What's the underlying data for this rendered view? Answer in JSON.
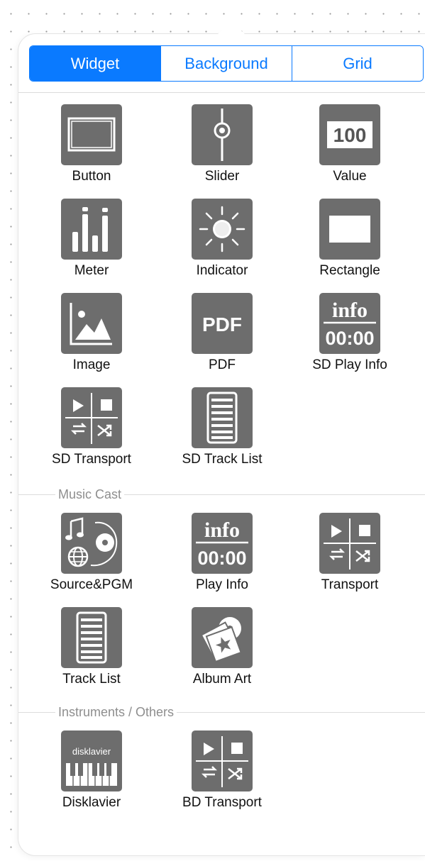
{
  "tabs": [
    "Widget",
    "Background",
    "Grid"
  ],
  "widgets": {
    "button": "Button",
    "slider": "Slider",
    "value": "Value",
    "value_icon_text": "100",
    "meter": "Meter",
    "indicator": "Indicator",
    "rectangle": "Rectangle",
    "image": "Image",
    "pdf": "PDF",
    "pdf_icon_text": "PDF",
    "sd_play_info": "SD Play Info",
    "sd_transport": "SD Transport",
    "sd_track_list": "SD Track List"
  },
  "music_cast": {
    "title": "Music Cast",
    "source_pgm": "Source&PGM",
    "play_info": "Play Info",
    "transport": "Transport",
    "track_list": "Track List",
    "album_art": "Album Art"
  },
  "instruments": {
    "title": "Instruments / Others",
    "disklavier": "Disklavier",
    "disklavier_icon_text": "disklavier",
    "bd_transport": "BD Transport"
  },
  "icon_text": {
    "info": "info",
    "time": "00:00"
  },
  "colors": {
    "accent": "#0a7aff",
    "tile": "#6d6d6d",
    "section_text": "#8e8e8e"
  }
}
